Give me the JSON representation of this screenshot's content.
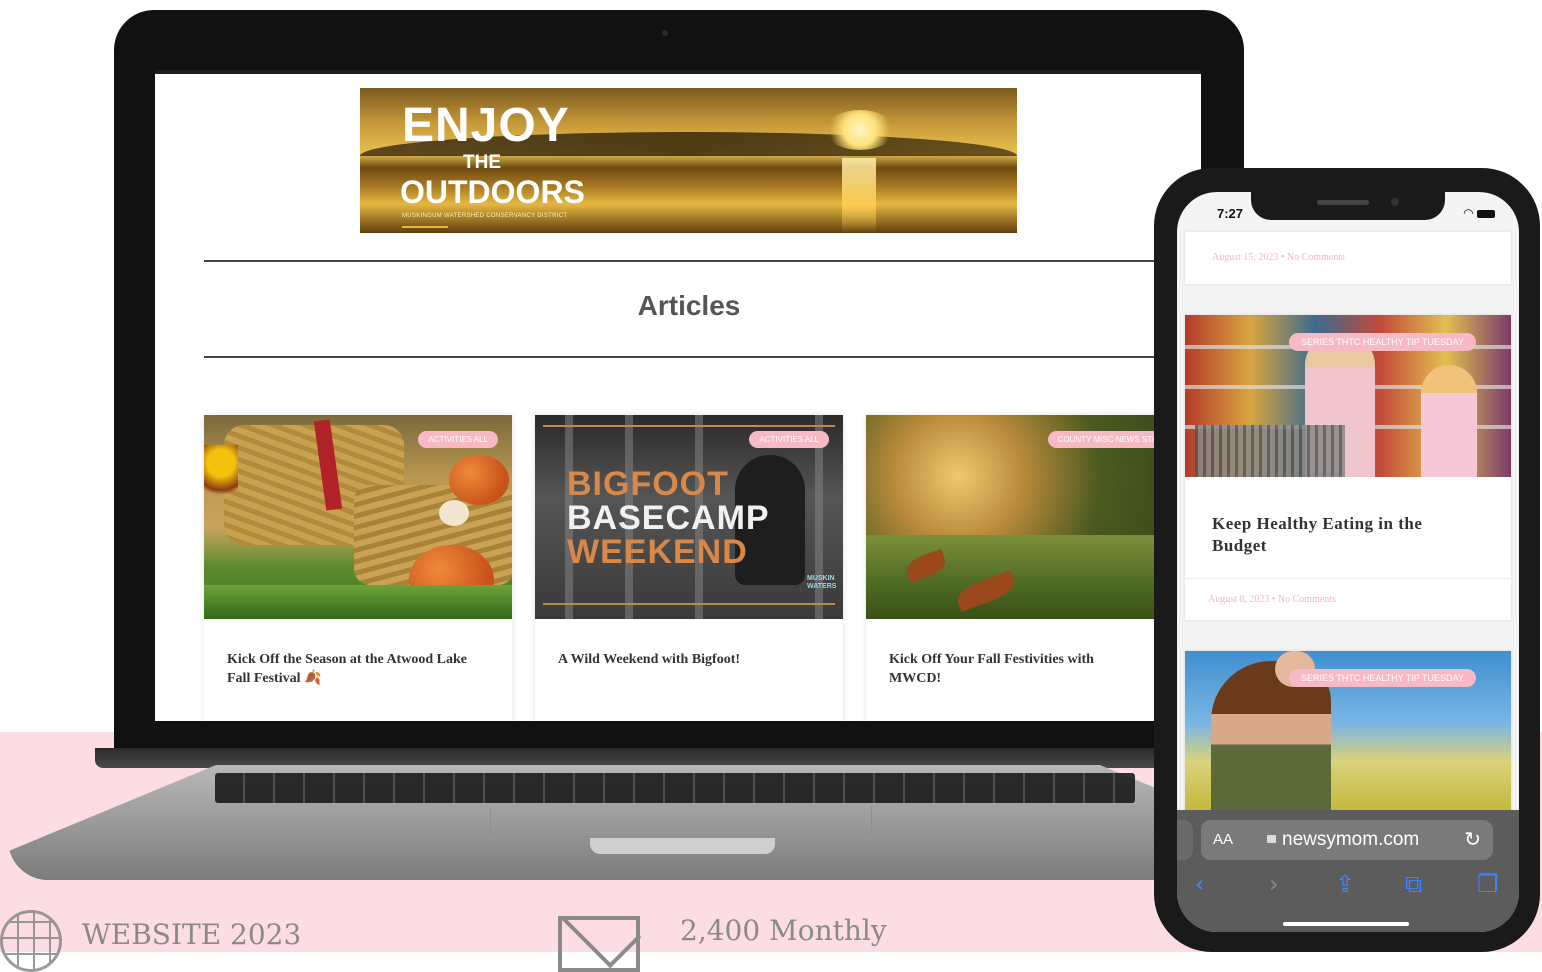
{
  "banner": {
    "line1": "ENJOY",
    "line2": "THE",
    "line3": "OUTDOORS",
    "org": "MUSKINGUM WATERSHED CONSERVANCY DISTRICT"
  },
  "laptop": {
    "section_title": "Articles",
    "cards": [
      {
        "category": "ACTIVITIES ALL",
        "title": "Kick Off the Season at the Atwood Lake Fall Festival 🍂"
      },
      {
        "category": "ACTIVITIES ALL",
        "title": "A Wild Weekend with Bigfoot!",
        "image_text": [
          "BIGFOOT",
          "BASECAMP",
          "WEEKEND"
        ],
        "image_logo": [
          "MUSKIN",
          "WATERS"
        ]
      },
      {
        "category": "COUNTY MISC NEWS STARK",
        "title": "Kick Off Your Fall Festivities with MWCD!"
      }
    ]
  },
  "phone": {
    "time": "7:27",
    "top_meta": "August 15, 2023  •  No Comments",
    "cards": [
      {
        "category": "SERIES THTC HEALTHY TIP TUESDAY",
        "title": "Keep Healthy Eating in the Budget",
        "meta": "August 8, 2023  •  No Comments"
      },
      {
        "category": "SERIES THTC HEALTHY TIP TUESDAY"
      }
    ],
    "browser": {
      "aa_label": "AA",
      "url": "newsymom.com"
    }
  },
  "stats": {
    "website": "WEBSITE 2023",
    "monthly": "2,400 Monthly"
  },
  "colors": {
    "pink_band": "#fcdde3",
    "badge_pink": "#f8b9c6",
    "stat_gray": "#8a8a8a",
    "ios_blue": "#3a86ff"
  },
  "icons": [
    "globe-icon",
    "mail-icon",
    "lock-icon",
    "reload-icon",
    "back-icon",
    "forward-icon",
    "share-icon",
    "bookmarks-icon",
    "tabs-icon",
    "wifi-icon",
    "battery-icon"
  ]
}
